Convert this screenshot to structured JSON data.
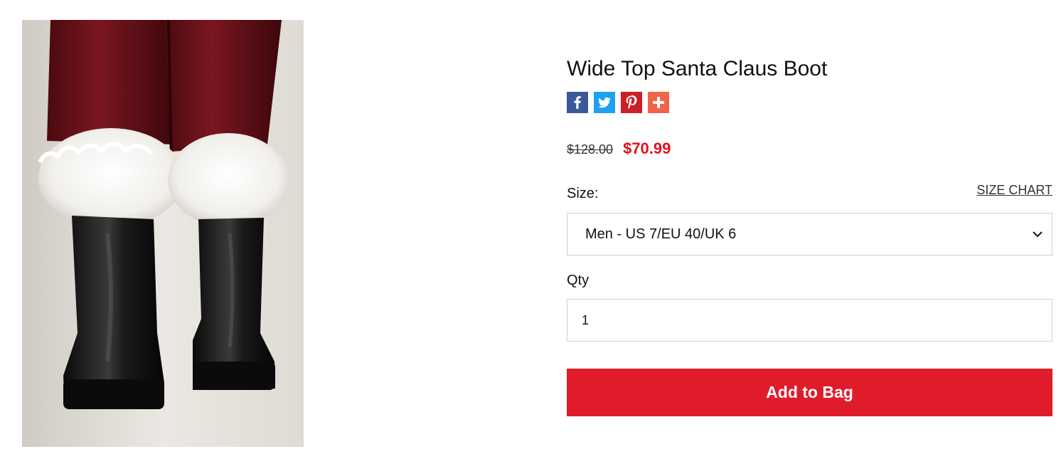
{
  "product": {
    "title": "Wide Top Santa Claus Boot",
    "image_alt": "Santa Claus boots with white fur cuffs"
  },
  "share": [
    {
      "name": "facebook",
      "icon": "facebook-icon",
      "glyph": "f",
      "color": "#3b5998"
    },
    {
      "name": "twitter",
      "icon": "twitter-icon",
      "glyph": "t",
      "color": "#1da1f2"
    },
    {
      "name": "pinterest",
      "icon": "pinterest-icon",
      "glyph": "p",
      "color": "#cb2027"
    },
    {
      "name": "more",
      "icon": "plus-icon",
      "glyph": "+",
      "color": "#f0644a"
    }
  ],
  "price": {
    "original": "$128.00",
    "sale": "$70.99",
    "sale_color": "#e4121b"
  },
  "size": {
    "label": "Size:",
    "chart_link": "SIZE CHART",
    "selected": "Men - US 7/EU 40/UK 6"
  },
  "qty": {
    "label": "Qty",
    "value": "1"
  },
  "cta": {
    "label": "Add to Bag",
    "color": "#e01b2a"
  }
}
